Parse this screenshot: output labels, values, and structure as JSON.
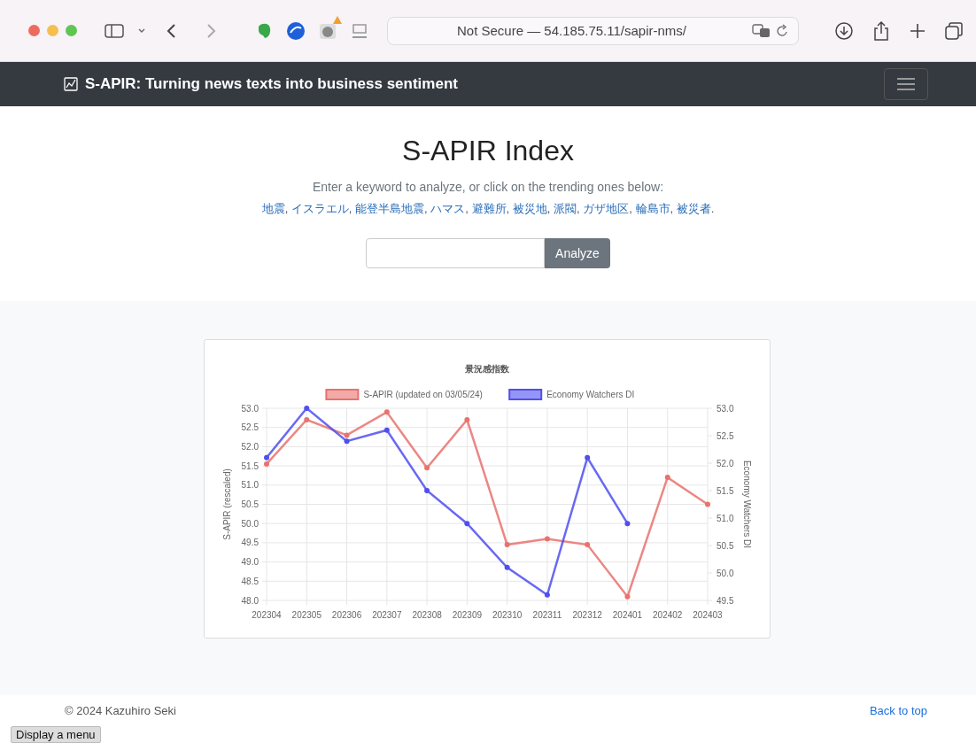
{
  "browser": {
    "address": "Not Secure — 54.185.75.11/sapir-nms/",
    "extension_badge": true
  },
  "navbar": {
    "brand": "S-APIR: Turning news texts into business sentiment"
  },
  "hero": {
    "title": "S-APIR Index",
    "prompt": "Enter a keyword to analyze, or click on the trending ones below:",
    "trending": [
      "地震",
      "イスラエル",
      "能登半島地震",
      "ハマス",
      "避難所",
      "被災地",
      "派閥",
      "ガザ地区",
      "輪島市",
      "被災者"
    ],
    "separator": ", ",
    "end": "."
  },
  "search": {
    "button": "Analyze"
  },
  "chart": {
    "chart_data": {
      "type": "line",
      "title": "景況感指数",
      "grid": true,
      "legend": "top",
      "ylabel": "S-APIR (rescaled)",
      "y2label": "Economy Watchers DI",
      "categories": [
        "202304",
        "202305",
        "202306",
        "202307",
        "202308",
        "202309",
        "202310",
        "202311",
        "202312",
        "202401",
        "202402",
        "202403"
      ],
      "ylim": [
        48,
        53
      ],
      "yticks": [
        {
          "value": 48,
          "label": "48.0"
        },
        48.5,
        {
          "value": 49,
          "label": "49.0"
        },
        49.5,
        {
          "value": 50,
          "label": "50.0"
        },
        50.5,
        {
          "value": 51,
          "label": "51.0"
        },
        51.5,
        {
          "value": 52,
          "label": "52.0"
        },
        52.5,
        {
          "value": 53,
          "label": "53.0"
        }
      ],
      "y2lim": [
        49.5,
        53
      ],
      "y2ticks": [
        49.5,
        {
          "value": 50,
          "label": "50.0"
        },
        50.5,
        {
          "value": 51,
          "label": "51.0"
        },
        51.5,
        {
          "value": 52,
          "label": "52.0"
        },
        52.5,
        {
          "value": 53,
          "label": "53.0"
        }
      ],
      "series": [
        {
          "name": "S-APIR (updated on 03/05/24)",
          "color": "#e8726e",
          "marker": "circle",
          "values": [
            51.55,
            52.7,
            52.3,
            52.9,
            51.45,
            52.7,
            49.45,
            49.6,
            49.45,
            48.1,
            51.2,
            50.5
          ]
        },
        {
          "name": "Economy Watchers DI",
          "color": "#4f4ff0",
          "axis": "y2",
          "marker": "circle",
          "values": [
            52.1,
            53.0,
            52.4,
            52.6,
            51.5,
            50.9,
            50.1,
            49.6,
            52.1,
            50.9,
            null,
            null
          ]
        }
      ]
    }
  },
  "footer": {
    "copyright": "© 2024 Kazuhiro Seki",
    "back_to_top": "Back to top"
  },
  "menu_button": "Display a menu"
}
